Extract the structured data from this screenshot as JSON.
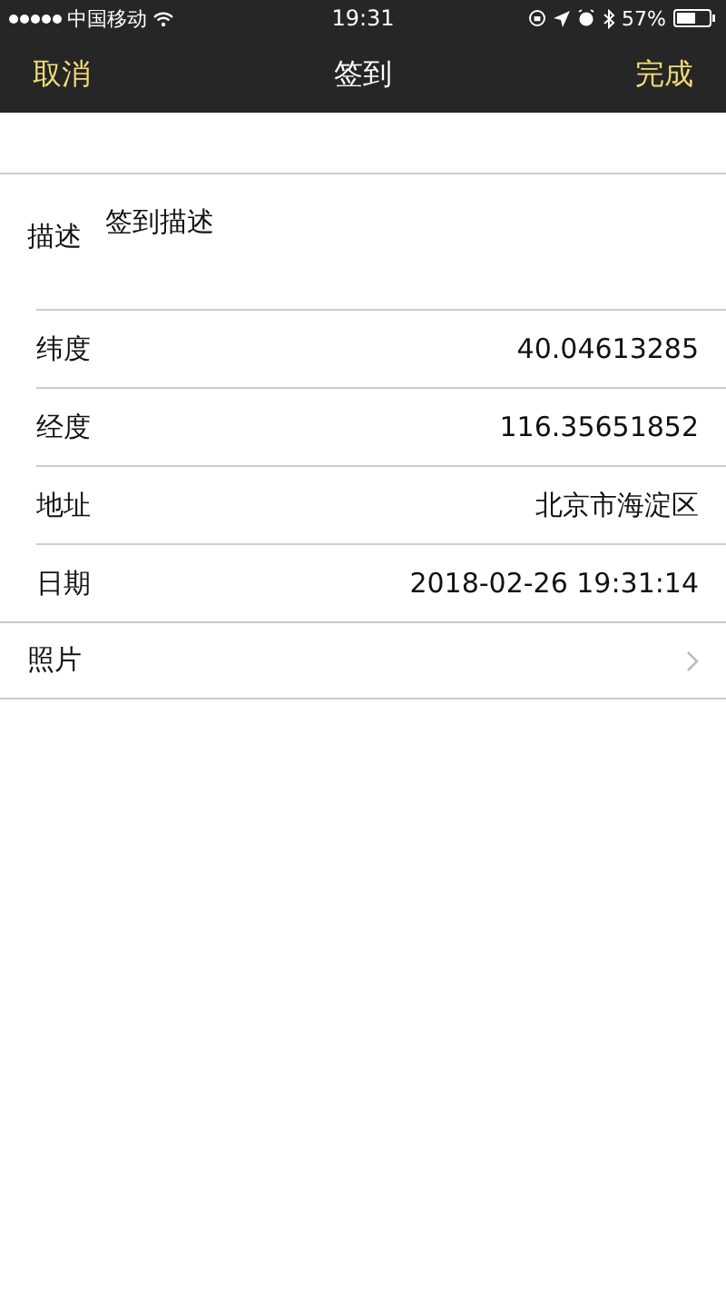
{
  "status_bar": {
    "carrier": "中国移动",
    "time": "19:31",
    "battery": "57%"
  },
  "nav": {
    "left": "取消",
    "title": "签到",
    "right": "完成"
  },
  "description": {
    "label": "描述",
    "value": "签到描述"
  },
  "fields": [
    {
      "label": "纬度",
      "value": "40.04613285"
    },
    {
      "label": "经度",
      "value": "116.35651852"
    },
    {
      "label": "地址",
      "value": "北京市海淀区"
    },
    {
      "label": "日期",
      "value": "2018-02-26 19:31:14"
    }
  ],
  "photo": {
    "label": "照片"
  }
}
